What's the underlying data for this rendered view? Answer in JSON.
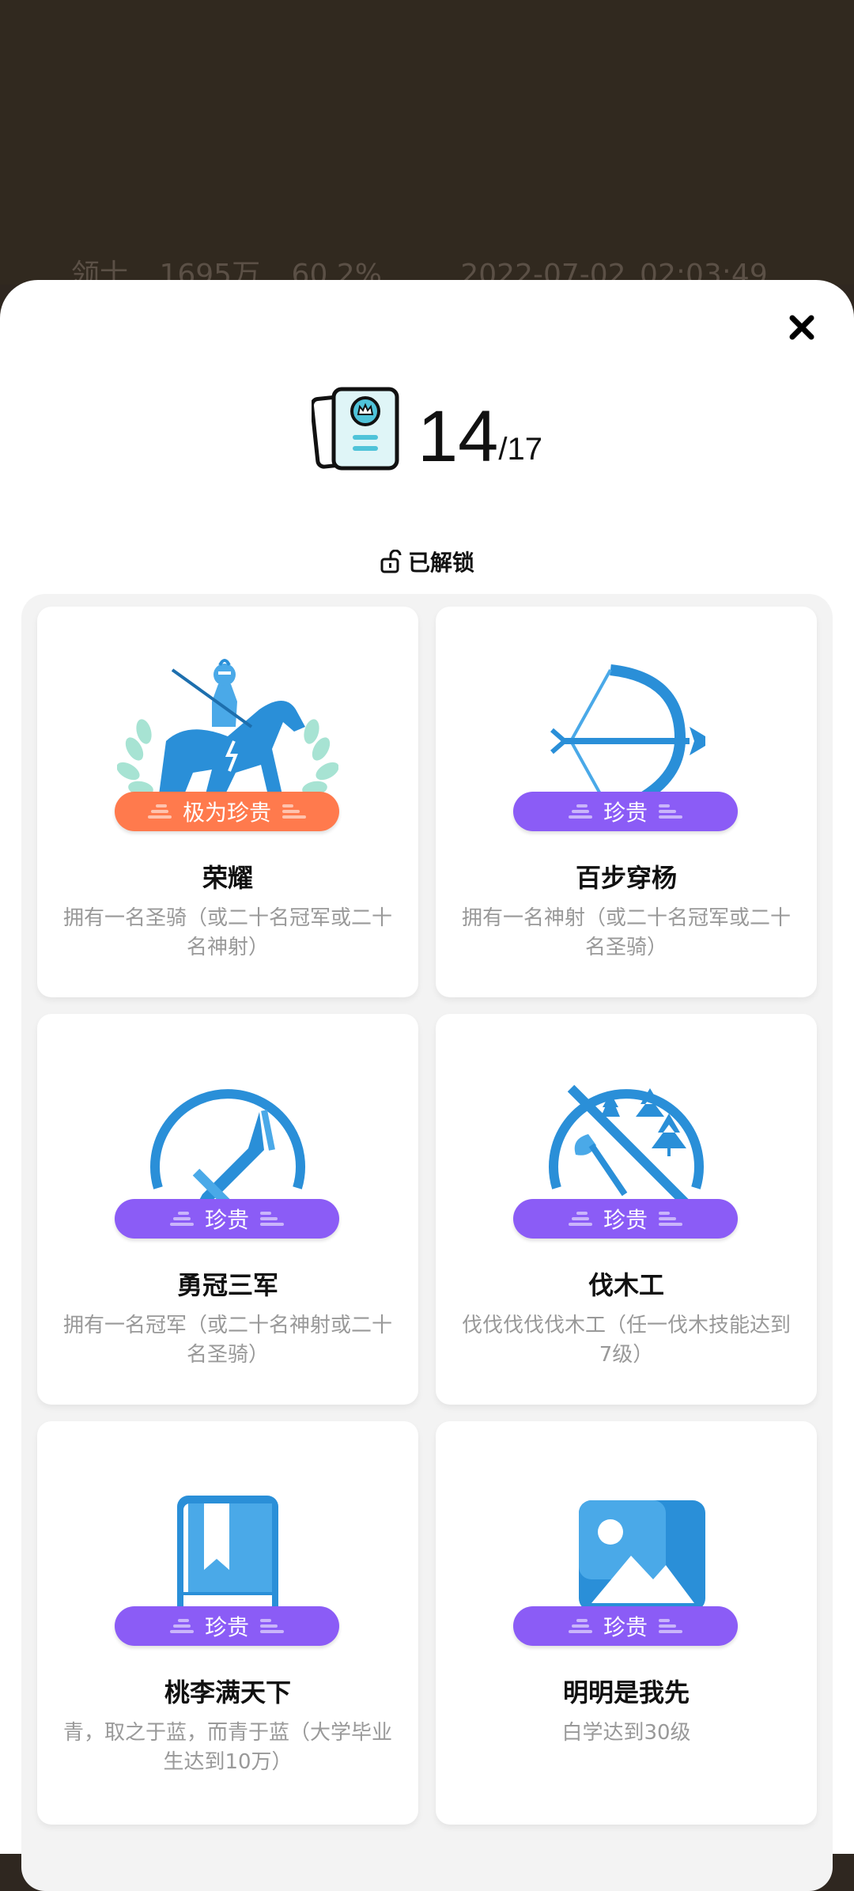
{
  "background_row": {
    "name": "领士",
    "amount": "1695万",
    "percent": "60.2%",
    "timestamp": "2022-07-02 02:03:49"
  },
  "sheet": {
    "close_icon": "close-icon",
    "counter": {
      "unlocked": "14",
      "total": "/17"
    },
    "status_label": "已解锁"
  },
  "achievements": [
    {
      "title": "荣耀",
      "rarity": "极为珍贵",
      "rarity_color": "#ff7a4d",
      "icon": "knight-horse-icon",
      "description": "拥有一名圣骑（或二十名冠军或二十名神射）"
    },
    {
      "title": "百步穿杨",
      "rarity": "珍贵",
      "rarity_color": "#8b5cf6",
      "icon": "bow-arrow-icon",
      "description": "拥有一名神射（或二十名冠军或二十名圣骑）"
    },
    {
      "title": "勇冠三军",
      "rarity": "珍贵",
      "rarity_color": "#8b5cf6",
      "icon": "sword-icon",
      "description": "拥有一名冠军（或二十名神射或二十名圣骑）"
    },
    {
      "title": "伐木工",
      "rarity": "珍贵",
      "rarity_color": "#8b5cf6",
      "icon": "axe-trees-icon",
      "description": "伐伐伐伐伐木工（任一伐木技能达到7级）"
    },
    {
      "title": "桃李满天下",
      "rarity": "珍贵",
      "rarity_color": "#8b5cf6",
      "icon": "book-icon",
      "description": "青，取之于蓝，而青于蓝（大学毕业生达到10万）"
    },
    {
      "title": "明明是我先",
      "rarity": "珍贵",
      "rarity_color": "#8b5cf6",
      "icon": "picture-icon",
      "description": "白学达到30级"
    }
  ]
}
